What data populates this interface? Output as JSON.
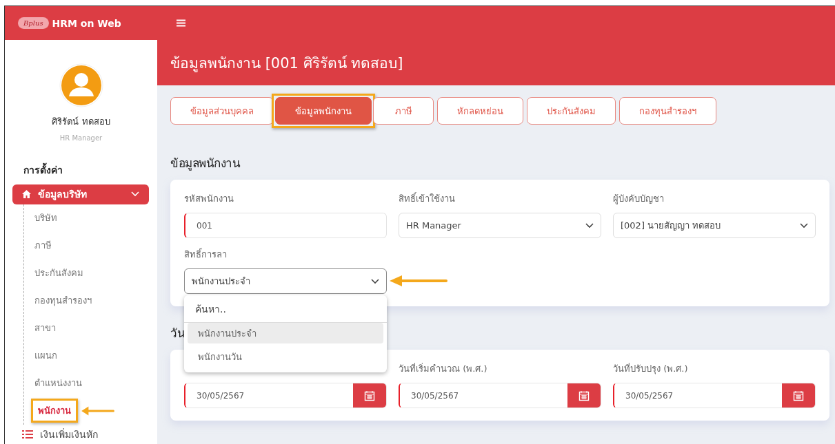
{
  "app": {
    "logo": "Bplus",
    "title": "HRM on Web"
  },
  "user": {
    "name": "ศิริรัตน์ ทดสอบ",
    "role": "HR Manager"
  },
  "sidebar": {
    "heading": "การตั้งค่า",
    "groups": [
      {
        "label": "ข้อมูลบริษัท",
        "expanded": true,
        "children": [
          {
            "label": "บริษัท",
            "selected": false,
            "highlighted": false
          },
          {
            "label": "ภาษี",
            "selected": false,
            "highlighted": false
          },
          {
            "label": "ประกันสังคม",
            "selected": false,
            "highlighted": false
          },
          {
            "label": "กองทุนสำรองฯ",
            "selected": false,
            "highlighted": false
          },
          {
            "label": "สาขา",
            "selected": false,
            "highlighted": false
          },
          {
            "label": "แผนก",
            "selected": false,
            "highlighted": false
          },
          {
            "label": "ตำแหน่งงาน",
            "selected": false,
            "highlighted": false
          },
          {
            "label": "พนักงาน",
            "selected": true,
            "highlighted": true
          }
        ]
      },
      {
        "label": "เงินเพิ่มเงินหัก",
        "expanded": false
      }
    ]
  },
  "page_title": "ข้อมูลพนักงาน [001 ศิริรัตน์ ทดสอบ]",
  "tabs": [
    {
      "label": "ข้อมูลส่วนบุคคล",
      "selected": false,
      "highlighted": false
    },
    {
      "label": "ข้อมูลพนักงาน",
      "selected": true,
      "highlighted": true
    },
    {
      "label": "ภาษี",
      "selected": false,
      "highlighted": false
    },
    {
      "label": "หักลดหย่อน",
      "selected": false,
      "highlighted": false
    },
    {
      "label": "ประกันสังคม",
      "selected": false,
      "highlighted": false
    },
    {
      "label": "กองทุนสำรองฯ",
      "selected": false,
      "highlighted": false
    }
  ],
  "sections": [
    {
      "title": "ข้อมูลพนักงาน",
      "fields": [
        {
          "kind": "text",
          "label": "รหัสพนักงาน",
          "value": "001",
          "required": true
        },
        {
          "kind": "select",
          "label": "สิทธิ์เข้าใช้งาน",
          "value": "HR Manager",
          "required": false
        },
        {
          "kind": "select",
          "label": "ผู้บังคับบัญชา",
          "value": "[002] นายสัญญา ทดสอบ",
          "required": false
        },
        {
          "kind": "select",
          "label": "สิทธิ์การลา",
          "value": "พนักงานประจำ",
          "required": false,
          "open": true,
          "pointer": true,
          "dropdown": {
            "search_placeholder": "ค้นหา..",
            "options": [
              {
                "label": "พนักงานประจำ",
                "selected": true
              },
              {
                "label": "พนักงานวัน",
                "selected": false
              }
            ]
          }
        }
      ]
    },
    {
      "title": "วัน",
      "fields": [
        {
          "kind": "date",
          "value": "30/05/2567",
          "required": true
        },
        {
          "kind": "date",
          "label": "วันที่เริ่มคำนวณ (พ.ศ.)",
          "value": "30/05/2567",
          "required": true
        },
        {
          "kind": "date",
          "label": "วันที่ปรับปรุง (พ.ศ.)",
          "value": "30/05/2567",
          "required": true
        }
      ]
    }
  ]
}
